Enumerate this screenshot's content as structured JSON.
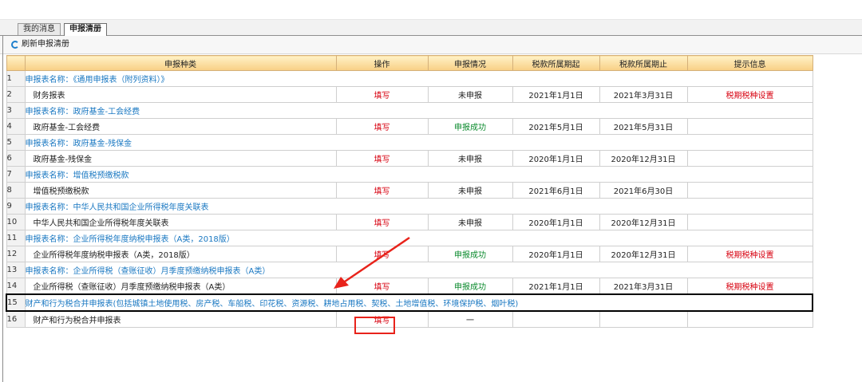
{
  "tabs": [
    {
      "label": "我的消息"
    },
    {
      "label": "申报清册"
    }
  ],
  "toolbar": {
    "refresh_label": "刷新申报清册"
  },
  "table": {
    "headers": {
      "type": "申报种类",
      "op": "操作",
      "status": "申报情况",
      "start": "税款所属期起",
      "end": "税款所属期止",
      "tip": "提示信息"
    },
    "rows": [
      {
        "n": "1",
        "kind": "cat",
        "name": "申报表名称：《通用申报表（附列资料）》"
      },
      {
        "n": "2",
        "kind": "sub",
        "name": "财务报表",
        "op": "填写",
        "status": "未申报",
        "status_class": "",
        "start": "2021年1月1日",
        "end": "2021年3月31日",
        "tip": "税期税种设置"
      },
      {
        "n": "3",
        "kind": "cat",
        "name": "申报表名称：政府基金-工会经费"
      },
      {
        "n": "4",
        "kind": "sub",
        "name": "政府基金-工会经费",
        "op": "填写",
        "status": "申报成功",
        "status_class": "green",
        "start": "2021年5月1日",
        "end": "2021年5月31日",
        "tip": ""
      },
      {
        "n": "5",
        "kind": "cat",
        "name": "申报表名称：政府基金-残保金"
      },
      {
        "n": "6",
        "kind": "sub",
        "name": "政府基金-残保金",
        "op": "填写",
        "status": "未申报",
        "status_class": "",
        "start": "2020年1月1日",
        "end": "2020年12月31日",
        "tip": ""
      },
      {
        "n": "7",
        "kind": "cat",
        "name": "申报表名称：增值税预缴税款"
      },
      {
        "n": "8",
        "kind": "sub",
        "name": "增值税预缴税款",
        "op": "填写",
        "status": "未申报",
        "status_class": "",
        "start": "2021年6月1日",
        "end": "2021年6月30日",
        "tip": ""
      },
      {
        "n": "9",
        "kind": "cat",
        "name": "申报表名称：中华人民共和国企业所得税年度关联表"
      },
      {
        "n": "10",
        "kind": "sub",
        "name": "中华人民共和国企业所得税年度关联表",
        "op": "填写",
        "status": "未申报",
        "status_class": "",
        "start": "2020年1月1日",
        "end": "2020年12月31日",
        "tip": ""
      },
      {
        "n": "11",
        "kind": "cat",
        "name": "申报表名称：企业所得税年度纳税申报表（A类，2018版）"
      },
      {
        "n": "12",
        "kind": "sub",
        "name": "企业所得税年度纳税申报表（A类，2018版）",
        "op": "填写",
        "status": "申报成功",
        "status_class": "green",
        "start": "2020年1月1日",
        "end": "2020年12月31日",
        "tip": "税期税种设置"
      },
      {
        "n": "13",
        "kind": "cat",
        "name": "申报表名称：企业所得税（查账征收）月季度预缴纳税申报表（A类）"
      },
      {
        "n": "14",
        "kind": "sub",
        "name": "企业所得税（查账征收）月季度预缴纳税申报表（A类）",
        "op": "填写",
        "status": "申报成功",
        "status_class": "green",
        "start": "2021年1月1日",
        "end": "2021年3月31日",
        "tip": "税期税种设置"
      },
      {
        "n": "15",
        "kind": "cat",
        "name": "财产和行为税合并申报表(包括城镇土地使用税、房产税、车船税、印花税、资源税、耕地占用税、契税、土地增值税、环境保护税、烟叶税)"
      },
      {
        "n": "16",
        "kind": "sub",
        "name": "财产和行为税合并申报表",
        "op": "填写",
        "status": "一",
        "status_class": "",
        "start": "",
        "end": "",
        "tip": ""
      }
    ]
  },
  "colors": {
    "red": "#d7000f",
    "green": "#0a8a2c",
    "blue": "#1a78c2",
    "highlight_box": "#e8231b",
    "header_orange": "#f8cf85"
  }
}
